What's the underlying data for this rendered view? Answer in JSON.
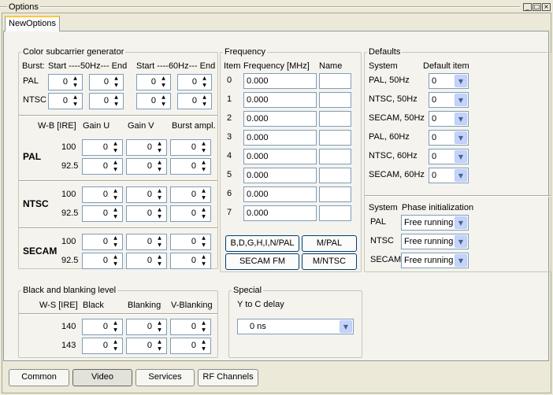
{
  "window": {
    "title": "Options",
    "tab": "NewOptions"
  },
  "color": {
    "title": "Color subcarrier generator",
    "burst_label": "Burst:",
    "hz50_header": "Start ----50Hz--- End",
    "hz60_header": "Start ----60Hz--- End",
    "rows": [
      {
        "label": "PAL",
        "values": [
          "0",
          "0",
          "0",
          "0"
        ]
      },
      {
        "label": "NTSC",
        "values": [
          "0",
          "0",
          "0",
          "0"
        ]
      }
    ],
    "gain_headers": {
      "wb": "W-B [IRE]",
      "u": "Gain U",
      "v": "Gain V",
      "burst": "Burst ampl."
    },
    "standards": [
      {
        "name": "PAL",
        "rows": [
          {
            "ire": "100",
            "values": [
              "0",
              "0",
              "0"
            ]
          },
          {
            "ire": "92.5",
            "values": [
              "0",
              "0",
              "0"
            ]
          }
        ]
      },
      {
        "name": "NTSC",
        "rows": [
          {
            "ire": "100",
            "values": [
              "0",
              "0",
              "0"
            ]
          },
          {
            "ire": "92.5",
            "values": [
              "0",
              "0",
              "0"
            ]
          }
        ]
      },
      {
        "name": "SECAM",
        "rows": [
          {
            "ire": "100",
            "values": [
              "0",
              "0",
              "0"
            ]
          },
          {
            "ire": "92.5",
            "values": [
              "0",
              "0",
              "0"
            ]
          }
        ]
      }
    ]
  },
  "frequency": {
    "title": "Frequency",
    "headers": {
      "item": "Item",
      "freq": "Frequency [MHz]",
      "name": "Name"
    },
    "rows": [
      {
        "item": "0",
        "freq": "0.000",
        "name": ""
      },
      {
        "item": "1",
        "freq": "0.000",
        "name": ""
      },
      {
        "item": "2",
        "freq": "0.000",
        "name": ""
      },
      {
        "item": "3",
        "freq": "0.000",
        "name": ""
      },
      {
        "item": "4",
        "freq": "0.000",
        "name": ""
      },
      {
        "item": "5",
        "freq": "0.000",
        "name": ""
      },
      {
        "item": "6",
        "freq": "0.000",
        "name": ""
      },
      {
        "item": "7",
        "freq": "0.000",
        "name": ""
      }
    ],
    "buttons": [
      "B,D,G,H,I,N/PAL",
      "M/PAL",
      "SECAM FM",
      "M/NTSC"
    ]
  },
  "defaults": {
    "title": "Defaults",
    "headers": {
      "system": "System",
      "item": "Default item"
    },
    "rows": [
      {
        "system": "PAL, 50Hz",
        "value": "0"
      },
      {
        "system": "NTSC, 50Hz",
        "value": "0"
      },
      {
        "system": "SECAM, 50Hz",
        "value": "0"
      },
      {
        "system": "PAL, 60Hz",
        "value": "0"
      },
      {
        "system": "NTSC, 60Hz",
        "value": "0"
      },
      {
        "system": "SECAM, 60Hz",
        "value": "0"
      }
    ],
    "phase_headers": {
      "system": "System",
      "phase": "Phase initialization"
    },
    "phase_rows": [
      {
        "system": "PAL",
        "value": "Free running"
      },
      {
        "system": "NTSC",
        "value": "Free running"
      },
      {
        "system": "SECAM",
        "value": "Free running"
      }
    ]
  },
  "blanking": {
    "title": "Black and blanking level",
    "headers": {
      "ws": "W-S [IRE]",
      "black": "Black",
      "blanking": "Blanking",
      "vblanking": "V-Blanking"
    },
    "rows": [
      {
        "ire": "140",
        "values": [
          "0",
          "0",
          "0"
        ]
      },
      {
        "ire": "143",
        "values": [
          "0",
          "0",
          "0"
        ]
      }
    ]
  },
  "special": {
    "title": "Special",
    "label": "Y to C delay",
    "value": "0 ns"
  },
  "bottom_tabs": [
    "Common",
    "Video",
    "Services",
    "RF Channels"
  ],
  "window_controls": [
    "_",
    "□",
    "×"
  ]
}
